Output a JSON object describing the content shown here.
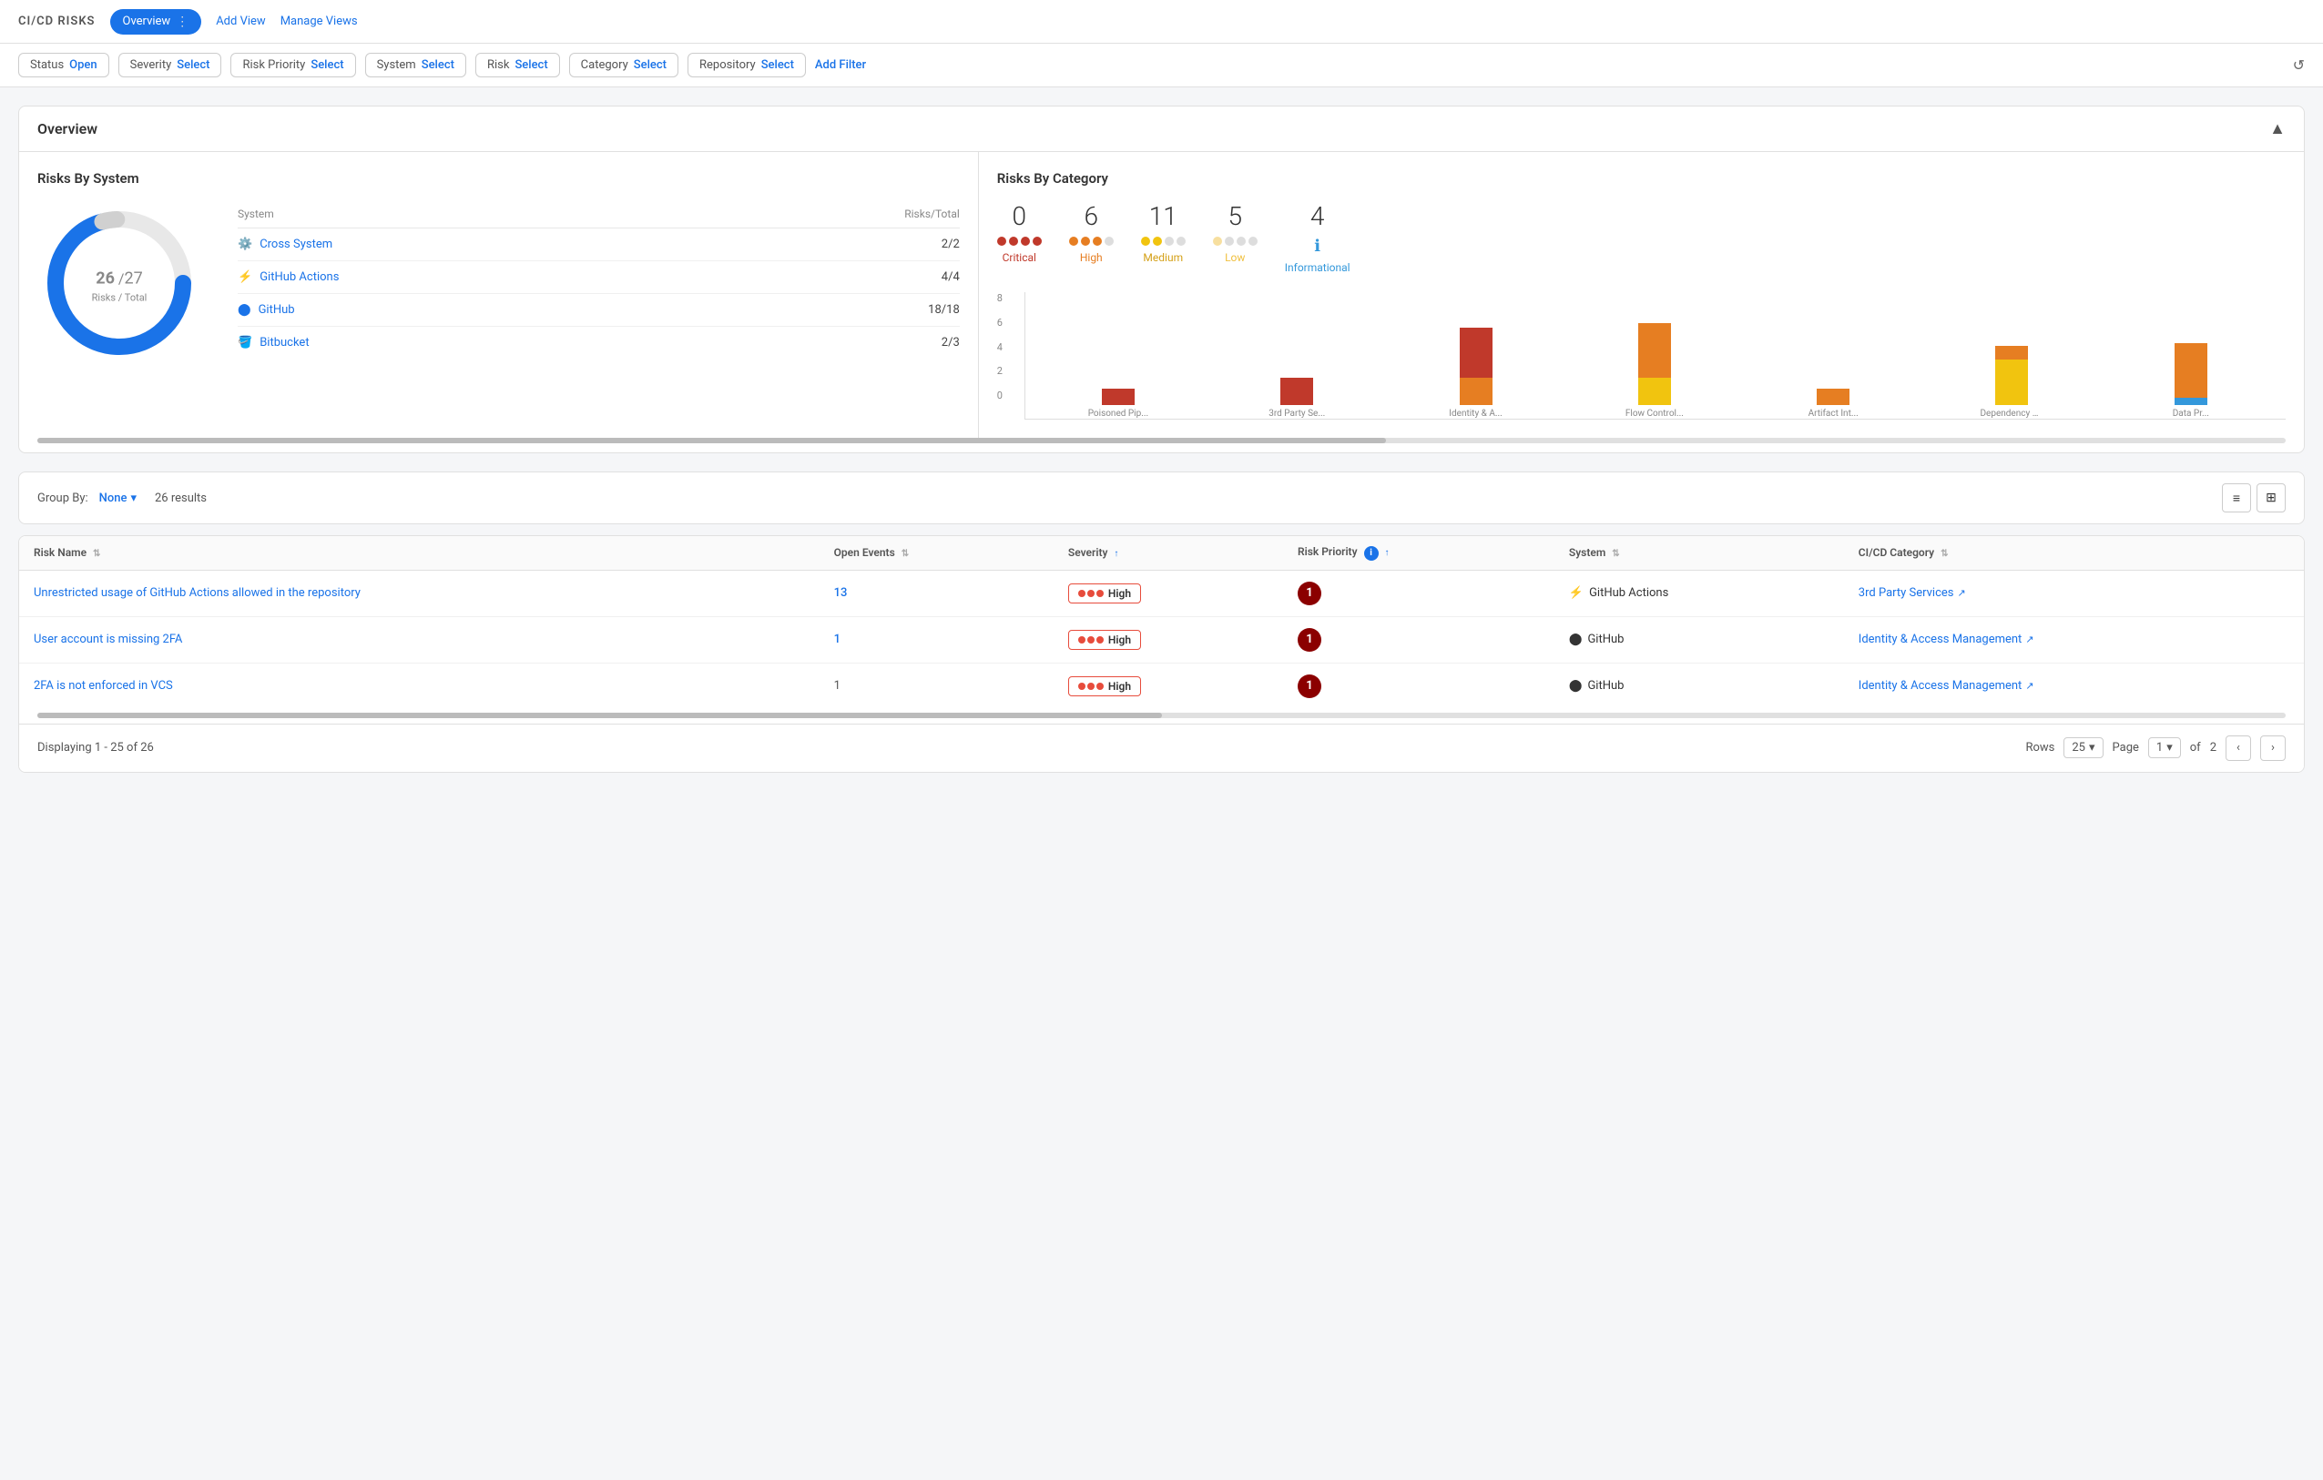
{
  "app": {
    "title": "CI/CD RISKS",
    "nav": {
      "active_tab": "Overview",
      "tabs": [
        "Overview"
      ],
      "links": [
        "Add View",
        "Manage Views"
      ]
    }
  },
  "filters": {
    "chips": [
      {
        "label": "Status",
        "value": "Open"
      },
      {
        "label": "Severity",
        "value": "Select"
      },
      {
        "label": "Risk Priority",
        "value": "Select"
      },
      {
        "label": "System",
        "value": "Select"
      },
      {
        "label": "Risk",
        "value": "Select"
      },
      {
        "label": "Category",
        "value": "Select"
      },
      {
        "label": "Repository",
        "value": "Select"
      }
    ],
    "add_filter_label": "Add Filter"
  },
  "overview": {
    "title": "Overview",
    "risks_by_system": {
      "title": "Risks By System",
      "donut": {
        "current": 26,
        "total": 27,
        "label": "Risks / Total"
      },
      "table_headers": [
        "System",
        "Risks/Total"
      ],
      "rows": [
        {
          "name": "Cross System",
          "count": "2/2",
          "icon": "cross-system"
        },
        {
          "name": "GitHub Actions",
          "count": "4/4",
          "icon": "github-actions"
        },
        {
          "name": "GitHub",
          "count": "18/18",
          "icon": "github"
        },
        {
          "name": "Bitbucket",
          "count": "2/3",
          "icon": "bitbucket"
        }
      ]
    },
    "risks_by_category": {
      "title": "Risks By Category",
      "legend": [
        {
          "count": 0,
          "label": "Critical",
          "color": "critical",
          "dots": [
            true,
            true,
            true,
            true
          ]
        },
        {
          "count": 6,
          "label": "High",
          "color": "high",
          "dots": [
            true,
            true,
            true,
            false
          ]
        },
        {
          "count": 11,
          "label": "Medium",
          "color": "medium",
          "dots": [
            true,
            true,
            false,
            false
          ]
        },
        {
          "count": 5,
          "label": "Low",
          "color": "low",
          "dots": [
            true,
            false,
            false,
            false
          ]
        },
        {
          "count": 4,
          "label": "Informational",
          "color": "info",
          "icon": true
        }
      ],
      "bars": [
        {
          "label": "Poisoned Pip...",
          "segments": [
            {
              "color": "#c0392b",
              "height": 18
            },
            {
              "color": "#e67e22",
              "height": 0
            },
            {
              "color": "#f1c40f",
              "height": 0
            },
            {
              "color": "#3498db",
              "height": 0
            }
          ]
        },
        {
          "label": "3rd Party Se...",
          "segments": [
            {
              "color": "#c0392b",
              "height": 30
            },
            {
              "color": "#e67e22",
              "height": 0
            },
            {
              "color": "#f1c40f",
              "height": 0
            },
            {
              "color": "#3498db",
              "height": 0
            }
          ]
        },
        {
          "label": "Identity & A...",
          "segments": [
            {
              "color": "#c0392b",
              "height": 50
            },
            {
              "color": "#e67e22",
              "height": 30
            },
            {
              "color": "#f1c40f",
              "height": 0
            },
            {
              "color": "#3498db",
              "height": 0
            }
          ]
        },
        {
          "label": "Flow Control...",
          "segments": [
            {
              "color": "#c0392b",
              "height": 0
            },
            {
              "color": "#e67e22",
              "height": 60
            },
            {
              "color": "#f1c40f",
              "height": 30
            },
            {
              "color": "#3498db",
              "height": 0
            }
          ]
        },
        {
          "label": "Artifact Int...",
          "segments": [
            {
              "color": "#c0392b",
              "height": 0
            },
            {
              "color": "#e67e22",
              "height": 18
            },
            {
              "color": "#f1c40f",
              "height": 0
            },
            {
              "color": "#3498db",
              "height": 0
            }
          ]
        },
        {
          "label": "Dependency C...",
          "segments": [
            {
              "color": "#c0392b",
              "height": 0
            },
            {
              "color": "#e67e22",
              "height": 15
            },
            {
              "color": "#f1c40f",
              "height": 50
            },
            {
              "color": "#3498db",
              "height": 0
            }
          ]
        },
        {
          "label": "Data Pr...",
          "segments": [
            {
              "color": "#c0392b",
              "height": 0
            },
            {
              "color": "#e67e22",
              "height": 60
            },
            {
              "color": "#f1c40f",
              "height": 0
            },
            {
              "color": "#3498db",
              "height": 8
            }
          ]
        }
      ],
      "y_axis": [
        "8",
        "6",
        "4",
        "2",
        "0"
      ]
    }
  },
  "results": {
    "group_by_label": "Group By:",
    "group_by_value": "None",
    "count": "26 results",
    "columns": [
      {
        "key": "risk_name",
        "label": "Risk Name",
        "sortable": true
      },
      {
        "key": "open_events",
        "label": "Open Events",
        "sortable": true
      },
      {
        "key": "severity",
        "label": "Severity",
        "sortable": true,
        "active": true
      },
      {
        "key": "risk_priority",
        "label": "Risk Priority",
        "sortable": true,
        "info": true
      },
      {
        "key": "system",
        "label": "System",
        "sortable": true
      },
      {
        "key": "cicd_category",
        "label": "CI/CD Category",
        "sortable": true
      }
    ],
    "rows": [
      {
        "risk_name": "Unrestricted usage of GitHub Actions allowed in the repository",
        "open_events": 13,
        "severity": "High",
        "severity_dots": 3,
        "risk_priority": 1,
        "system": "GitHub Actions",
        "system_icon": "github-actions",
        "cicd_category": "3rd Party Services",
        "category_link": true
      },
      {
        "risk_name": "User account is missing 2FA",
        "open_events": 1,
        "severity": "High",
        "severity_dots": 3,
        "risk_priority": 1,
        "system": "GitHub",
        "system_icon": "github",
        "cicd_category": "Identity & Access Management",
        "category_link": true
      },
      {
        "risk_name": "2FA is not enforced in VCS",
        "open_events": 1,
        "severity": "High",
        "severity_dots": 3,
        "risk_priority": 1,
        "system": "GitHub",
        "system_icon": "github",
        "cicd_category": "Identity & Access Management",
        "category_link": true
      }
    ]
  },
  "pagination": {
    "display_info": "Displaying 1 - 25 of 26",
    "rows_label": "Rows",
    "rows_per_page": "25",
    "page_label": "Page",
    "current_page": "1",
    "total_pages": "2"
  }
}
